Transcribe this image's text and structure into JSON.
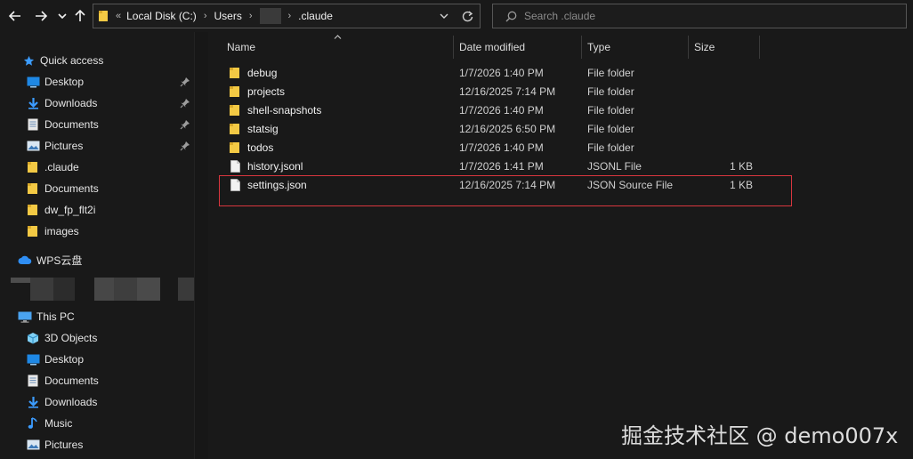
{
  "toolbar": {
    "back_icon": "arrow-left-icon",
    "forward_icon": "arrow-right-icon",
    "recent_icon": "chevron-down-icon",
    "up_icon": "arrow-up-icon"
  },
  "address": {
    "overflow": "«",
    "crumbs": [
      "Local Disk (C:)",
      "Users",
      ".claude"
    ],
    "separator": "›"
  },
  "search": {
    "placeholder": "Search .claude"
  },
  "sidebar": {
    "quick_access": "Quick access",
    "quick_items": [
      "Desktop",
      "Downloads",
      "Documents",
      "Pictures",
      ".claude",
      "Documents",
      "dw_fp_flt2i",
      "images"
    ],
    "wps": "WPS云盘",
    "this_pc": "This PC",
    "pc_items": [
      "3D Objects",
      "Desktop",
      "Documents",
      "Downloads",
      "Music",
      "Pictures"
    ]
  },
  "columns": {
    "name": "Name",
    "date": "Date modified",
    "type": "Type",
    "size": "Size"
  },
  "files": [
    {
      "name": "debug",
      "date": "1/7/2026 1:40 PM",
      "type": "File folder",
      "size": "",
      "icon": "folder-icon"
    },
    {
      "name": "projects",
      "date": "12/16/2025 7:14 PM",
      "type": "File folder",
      "size": "",
      "icon": "folder-icon"
    },
    {
      "name": "shell-snapshots",
      "date": "1/7/2026 1:40 PM",
      "type": "File folder",
      "size": "",
      "icon": "folder-icon"
    },
    {
      "name": "statsig",
      "date": "12/16/2025 6:50 PM",
      "type": "File folder",
      "size": "",
      "icon": "folder-icon"
    },
    {
      "name": "todos",
      "date": "1/7/2026 1:40 PM",
      "type": "File folder",
      "size": "",
      "icon": "folder-icon"
    },
    {
      "name": "history.jsonl",
      "date": "1/7/2026 1:41 PM",
      "type": "JSONL File",
      "size": "1 KB",
      "icon": "file-icon"
    },
    {
      "name": "settings.json",
      "date": "12/16/2025 7:14 PM",
      "type": "JSON Source File",
      "size": "1 KB",
      "icon": "file-icon"
    }
  ],
  "watermark": "掘金技术社区 @ demo007x",
  "colors": {
    "folder": "#f3c944",
    "accent": "#3c9cff",
    "highlight": "#d9363e"
  }
}
